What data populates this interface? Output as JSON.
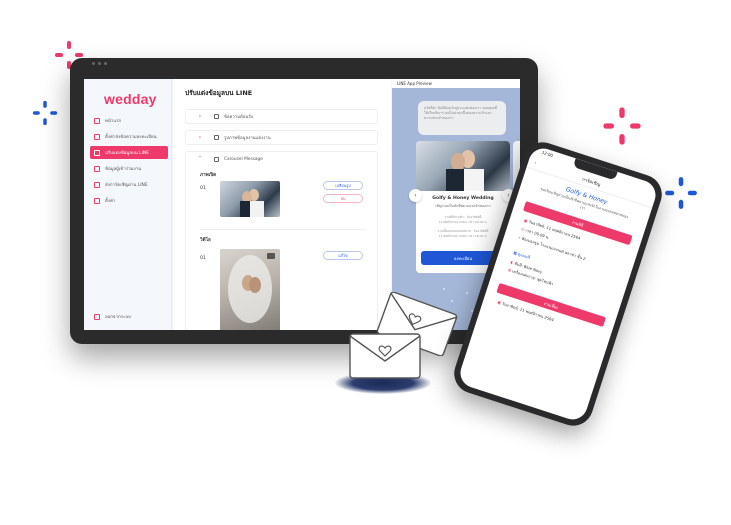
{
  "brand": {
    "logo_text": "wedday",
    "accent": "#ee3a6b",
    "link_blue": "#1f57d6"
  },
  "sidebar": {
    "items": [
      {
        "label": "หน้าแรก",
        "icon": "home-icon",
        "active": false
      },
      {
        "label": "ตั้งค่าส่งข้อความลงทะเบียน",
        "icon": "edit-icon",
        "active": false
      },
      {
        "label": "ปรับแต่งข้อมูลบน LINE",
        "icon": "line-icon",
        "active": true
      },
      {
        "label": "ข้อมูลผู้เข้าร่วมงาน",
        "icon": "users-icon",
        "active": false
      },
      {
        "label": "ส่งการ์ดเชิญผ่าน LINE",
        "icon": "send-icon",
        "active": false
      },
      {
        "label": "ตั้งค่า",
        "icon": "gear-icon",
        "active": false
      }
    ],
    "logout_label": "ออกจากระบบ"
  },
  "main": {
    "title": "ปรับแต่งข้อมูลบน LINE",
    "sections": [
      {
        "label": "ข้อความต้อนรับ",
        "icon": "chat-icon"
      },
      {
        "label": "รูปภาพข้อมูลงานแต่งงาน",
        "icon": "image-icon"
      },
      {
        "label": "Carousel Message",
        "icon": "image-icon"
      }
    ],
    "photo_section_label": "ภาพเปิด",
    "video_section_label": "วิดีโอ",
    "row_number": "01",
    "change_image_button": "เปลี่ยนรูป",
    "delete_button": "ลบ",
    "edit_button": "แก้ไข"
  },
  "preview": {
    "header": "LINE App Preview",
    "bubble_text": "สวัสดีค่ะ ยินดีต้อนรับสู่งานแต่งของเรา ขอบคุณที่ให้เกียรติมาร่วมเป็นส่วนหนึ่งของความรักและความทรงจำของเรา",
    "card_title": "Golfy & Honey Wedding",
    "card_subtitle": "เชิญร่วมเป็นสักขีพยานแห่งรักของเรา",
    "card_line_1": "งานพิธีช่วงเช้า : วันอาทิตย์ที่",
    "card_line_2": "11 พฤศจิกายน 2564 เวลา 09.09 น.",
    "card_line_3": "งานเลี้ยงฉลองมงคลสมรส : วันอาทิตย์ที่",
    "card_line_4": "11 พฤศจิกายน 2564 เวลา 18.00 น.",
    "register_button": "ลงทะเบียน",
    "prev_icon": "chevron-left-icon",
    "next_icon": "chevron-right-icon"
  },
  "phone": {
    "time": "12:00",
    "header_title": "การ์ดเชิญ",
    "title": "Golfy & Honey",
    "invite_text": "ขอเรียนเชิญร่วมเป็นสักขีพยานแห่งรักในงานมงคลสมรสของเรา",
    "morning_button": "งานพิธี",
    "event_date": "วันอาทิตย์, 11 พฤศจิกายน 2564",
    "event_time": "เวลา 09.09 น.",
    "venue": "ห้องบอลรูม โรงแรมแกรนด์ พลาซ่า ชั้น 2",
    "map_link": "ดูแผนที่",
    "theme_color_label": "ธีมสี: Blue Navy",
    "dress_label": "เครื่องแต่งกาย: ชุดโทนฟ้า",
    "evening_button": "งานเลี้ยง",
    "evening_date": "วันอาทิตย์, 11 พฤศจิกายน 2564"
  }
}
